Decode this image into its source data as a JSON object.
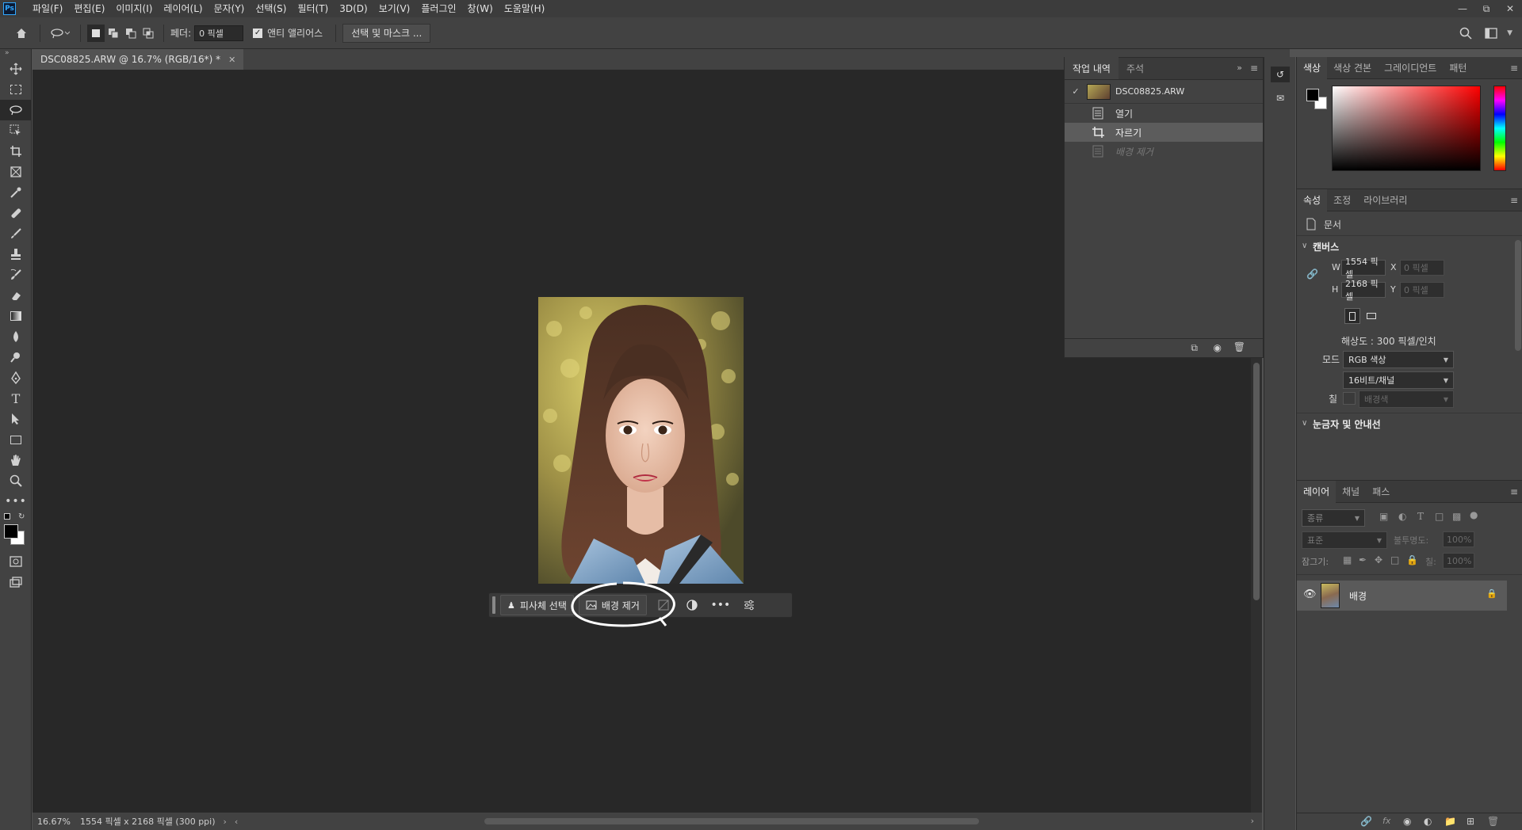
{
  "menubar": {
    "logo": "Ps",
    "items": [
      "파일(F)",
      "편집(E)",
      "이미지(I)",
      "레이어(L)",
      "문자(Y)",
      "선택(S)",
      "필터(T)",
      "3D(D)",
      "보기(V)",
      "플러그인",
      "창(W)",
      "도움말(H)"
    ]
  },
  "options": {
    "feather_label": "페더:",
    "feather_value": "0 픽셀",
    "antialias_label": "앤티 앨리어스",
    "select_mask_label": "선택 및 마스크 ..."
  },
  "document": {
    "tab_label": "DSC08825.ARW @ 16.7% (RGB/16*) *",
    "zoom": "16.67%",
    "dimensions": "1554 픽셀 x 2168 픽셀 (300 ppi)"
  },
  "taskbar": {
    "select_subject": "피사체 선택",
    "remove_background": "배경 제거"
  },
  "history": {
    "tabs": [
      "작업 내역",
      "주석"
    ],
    "snapshot": "DSC08825.ARW",
    "steps": [
      "열기",
      "자르기",
      "배경 제거"
    ]
  },
  "color_panel": {
    "tabs": [
      "색상",
      "색상 견본",
      "그레이디언트",
      "패턴"
    ],
    "accent_color": "#ff0000"
  },
  "properties": {
    "tabs": [
      "속성",
      "조정",
      "라이브러리"
    ],
    "doc_label": "문서",
    "canvas_header": "캔버스",
    "w_label": "W",
    "w_value": "1554 픽셀",
    "h_label": "H",
    "h_value": "2168 픽셀",
    "x_label": "X",
    "x_value": "0 픽셀",
    "y_label": "Y",
    "y_value": "0 픽셀",
    "resolution": "해상도 : 300 픽셀/인치",
    "mode_label": "모드",
    "mode_value": "RGB 색상",
    "depth_value": "16비트/채널",
    "fill_label": "칠",
    "fill_value": "배경색",
    "rulers_header": "눈금자 및 안내선"
  },
  "layers": {
    "tabs": [
      "레이어",
      "채널",
      "패스"
    ],
    "filter_label": "종류",
    "blend_mode": "표준",
    "opacity_label": "불투명도:",
    "opacity_value": "100%",
    "lock_label": "잠그기:",
    "fill_label": "칠:",
    "fill_value": "100%",
    "layer_name": "배경"
  }
}
